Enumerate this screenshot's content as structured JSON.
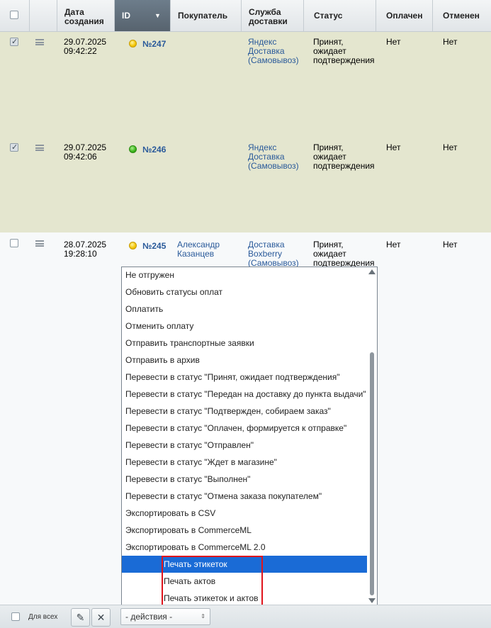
{
  "headers": {
    "date": [
      "Дата",
      "создания"
    ],
    "id": "ID",
    "buyer": "Покупатель",
    "delivery": [
      "Служба",
      "доставки"
    ],
    "status": "Статус",
    "paid": "Оплачен",
    "cancelled": "Отменен"
  },
  "rows": [
    {
      "date": "29.07.2025",
      "time": "09:42:22",
      "status_color": "yellow",
      "id": "№247",
      "buyer": [
        "",
        ""
      ],
      "delivery": [
        "Яндекс",
        "Доставка",
        "(Самовывоз)"
      ],
      "status": [
        "Принят,",
        "ожидает",
        "подтверждения"
      ],
      "paid": "Нет",
      "cancelled": "Нет",
      "checked": true
    },
    {
      "date": "29.07.2025",
      "time": "09:42:06",
      "status_color": "green",
      "id": "№246",
      "buyer": [
        "",
        ""
      ],
      "delivery": [
        "Яндекс",
        "Доставка",
        "(Самовывоз)"
      ],
      "status": [
        "Принят,",
        "ожидает",
        "подтверждения"
      ],
      "paid": "Нет",
      "cancelled": "Нет",
      "checked": true
    },
    {
      "date": "28.07.2025",
      "time": "19:28:10",
      "status_color": "yellow",
      "id": "№245",
      "buyer": [
        "Александр",
        "Казанцев"
      ],
      "delivery": [
        "Доставка",
        "Boxberry",
        "(Самовывоз)"
      ],
      "status": [
        "Принят,",
        "ожидает",
        "подтверждения"
      ],
      "paid": "Нет",
      "cancelled": "Нет",
      "checked": false
    }
  ],
  "dropdown": {
    "options": [
      "Не отгружен",
      "Обновить статусы оплат",
      "Оплатить",
      "Отменить оплату",
      "Отправить транспортные заявки",
      "Отправить в архив",
      "Перевести в статус \"Принят, ожидает подтверждения\"",
      "Перевести в статус \"Передан на доставку до пункта выдачи\"",
      "Перевести в статус \"Подтвержден, собираем заказ\"",
      "Перевести в статус \"Оплачен, формируется к отправке\"",
      "Перевести в статус \"Отправлен\"",
      "Перевести в статус \"Ждет в магазине\"",
      "Перевести в статус \"Выполнен\"",
      "Перевести в статус \"Отмена заказа покупателем\"",
      "Экспортировать в CSV",
      "Экспортировать в CommerceML",
      "Экспортировать в CommerceML 2.0",
      "Печать этикеток",
      "Печать актов",
      "Печать этикеток и актов"
    ],
    "highlighted": "Печать этикеток"
  },
  "footer": {
    "for_all_label": "Для всех",
    "actions_select": "- действия -",
    "edit_icon": "pencil-icon",
    "delete_icon": "close-icon"
  },
  "colors": {
    "selected_row": "#e4e6cf",
    "highlight": "#1a6bd6",
    "annotation": "#e0141c",
    "link": "#2a5a9a"
  }
}
